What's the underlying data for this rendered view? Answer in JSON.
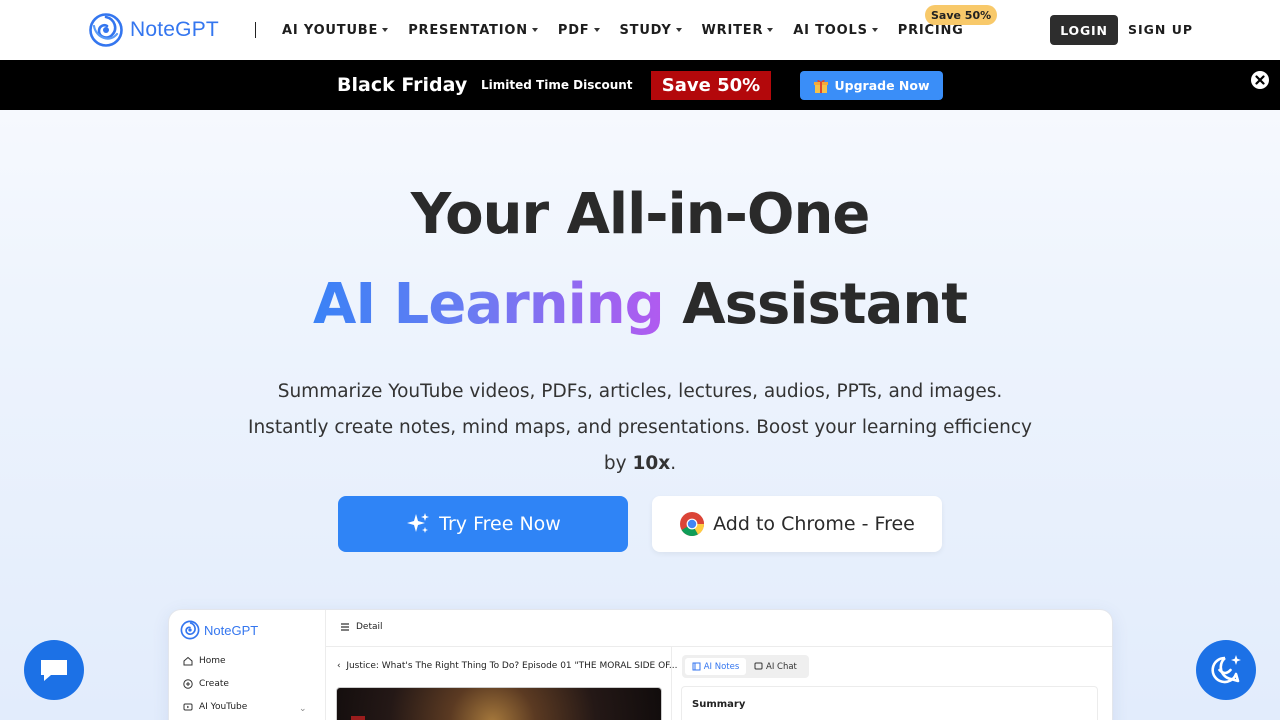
{
  "brand": {
    "name": "NoteGPT",
    "accent": "#3476ef"
  },
  "nav": {
    "items": [
      {
        "label": "AI YOUTUBE",
        "dropdown": true
      },
      {
        "label": "PRESENTATION",
        "dropdown": true
      },
      {
        "label": "PDF",
        "dropdown": true
      },
      {
        "label": "STUDY",
        "dropdown": true
      },
      {
        "label": "WRITER",
        "dropdown": true
      },
      {
        "label": "AI TOOLS",
        "dropdown": true
      },
      {
        "label": "PRICING",
        "dropdown": false
      }
    ],
    "pricing_badge": "Save 50%",
    "login": "LOGIN",
    "signup": "SIGN UP"
  },
  "promo": {
    "title": "Black Friday",
    "subtitle": "Limited Time Discount",
    "save": "Save 50%",
    "upgrade": "Upgrade Now",
    "colors": {
      "background": "#000000",
      "save": "#b3080b",
      "upgrade": "#3a8ef8"
    }
  },
  "hero": {
    "line1": "Your All-in-One",
    "line2_highlight": "AI Learning",
    "line2_rest": "Assistant",
    "description_part1": "Summarize YouTube videos, PDFs, articles, lectures, audios, PPTs, and images. Instantly create notes, mind maps, and presentations. Boost your learning efficiency by ",
    "description_bold": "10x",
    "description_end": ".",
    "primary_cta": "Try Free Now",
    "secondary_cta": "Add to Chrome - Free",
    "primary_color": "#2f84f6"
  },
  "preview": {
    "logo": "NoteGPT",
    "sidebar": [
      {
        "label": "Home",
        "icon": "home-icon"
      },
      {
        "label": "Create",
        "icon": "plus-circle-icon"
      },
      {
        "label": "AI YouTube",
        "icon": "youtube-icon"
      }
    ],
    "header": "Detail",
    "video_title": "Justice: What's The Right Thing To Do? Episode 01 \"THE MORAL SIDE OF...",
    "tabs": [
      {
        "label": "AI Notes",
        "active": true
      },
      {
        "label": "AI Chat",
        "active": false
      }
    ],
    "summary_heading": "Summary"
  }
}
